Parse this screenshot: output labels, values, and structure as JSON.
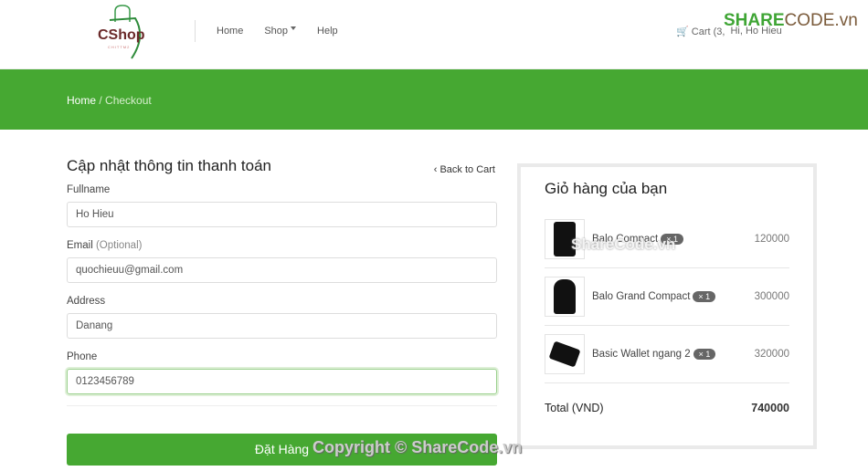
{
  "brand": {
    "name": "CShop",
    "tagline": "CHITTM2"
  },
  "nav": {
    "links": [
      "Home",
      "Shop",
      "Help"
    ],
    "cart": "Cart (3,",
    "user": "Hi, Ho Hieu"
  },
  "breadcrumb": {
    "home": "Home",
    "separator": " / ",
    "current": "Checkout"
  },
  "form": {
    "title": "Cập nhật thông tin thanh toán",
    "back": "Back to Cart",
    "fields": [
      {
        "label": "Fullname",
        "optional": "",
        "value": "Ho Hieu"
      },
      {
        "label": "Email",
        "optional": "(Optional)",
        "value": "quochieuu@gmail.com"
      },
      {
        "label": "Address",
        "optional": "",
        "value": "Danang"
      },
      {
        "label": "Phone",
        "optional": "",
        "value": "0123456789"
      }
    ],
    "submit": "Đặt Hàng"
  },
  "cart": {
    "title": "Giỏ hàng của bạn",
    "items": [
      {
        "name": "Balo Compact",
        "qty": "× 1",
        "price": "120000"
      },
      {
        "name": "Balo Grand Compact",
        "qty": "× 1",
        "price": "300000"
      },
      {
        "name": "Basic Wallet ngang 2",
        "qty": "× 1",
        "price": "320000"
      }
    ],
    "total_label": "Total (VND)",
    "total": "740000"
  },
  "watermarks": {
    "logo": "SHARECODE.vn",
    "center": "ShareCode.vn",
    "footer": "Copyright © ShareCode.vn"
  },
  "colors": {
    "accent": "#46a832"
  }
}
